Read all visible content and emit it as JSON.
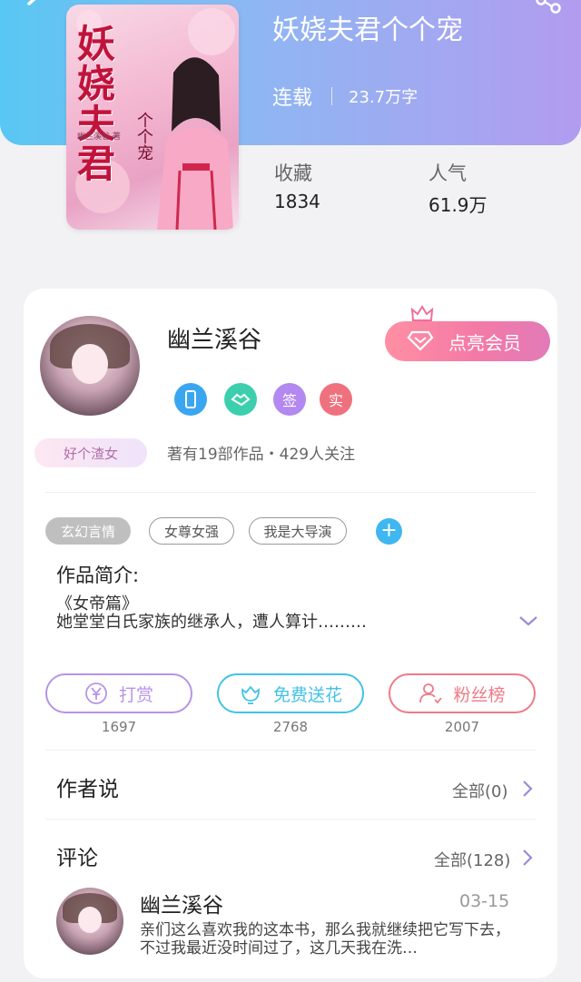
{
  "book": {
    "title": "妖娆夫君个个宠",
    "status": "连载",
    "word_count": "23.7万字",
    "cover_title": "妖娆夫君",
    "cover_subtitle": "个个宠",
    "cover_author": "幽兰溪谷 著",
    "stats": {
      "favorites_label": "收藏",
      "favorites_value": "1834",
      "popularity_label": "人气",
      "popularity_value": "61.9万"
    }
  },
  "author": {
    "name": "幽兰溪谷",
    "vip_button": "点亮会员",
    "badges": [
      {
        "icon": "phone-badge-icon",
        "text": "",
        "color": "#3aa6f0"
      },
      {
        "icon": "handshake-badge-icon",
        "text": "",
        "color": "#3ccfae"
      },
      {
        "icon": "sign-badge-icon",
        "text": "签",
        "color": "#b388f0"
      },
      {
        "icon": "verified-badge-icon",
        "text": "实",
        "color": "#f0717e"
      }
    ],
    "tag": "好个渣女",
    "meta": "著有19部作品・429人关注"
  },
  "tags": [
    "玄幻言情",
    "女尊女强",
    "我是大导演"
  ],
  "intro": {
    "label": "作品简介:",
    "line1": "《女帝篇》",
    "line2": "她堂堂白氏家族的继承人，遭人算计………"
  },
  "actions": [
    {
      "label": "打赏",
      "count": "1697",
      "color": "#b793e8",
      "icon": "yen-icon"
    },
    {
      "label": "免费送花",
      "count": "2768",
      "color": "#43c2e6",
      "icon": "flower-icon"
    },
    {
      "label": "粉丝榜",
      "count": "2007",
      "color": "#f07a86",
      "icon": "fans-icon"
    }
  ],
  "author_says": {
    "title": "作者说",
    "link": "全部(0)"
  },
  "comments": {
    "title": "评论",
    "link": "全部(128)",
    "items": [
      {
        "name": "幽兰溪谷",
        "date": "03-15",
        "text": "亲们这么喜欢我的这本书，那么我就继续把它写下去，不过我最近没时间过了，这几天我在洗…"
      }
    ]
  }
}
